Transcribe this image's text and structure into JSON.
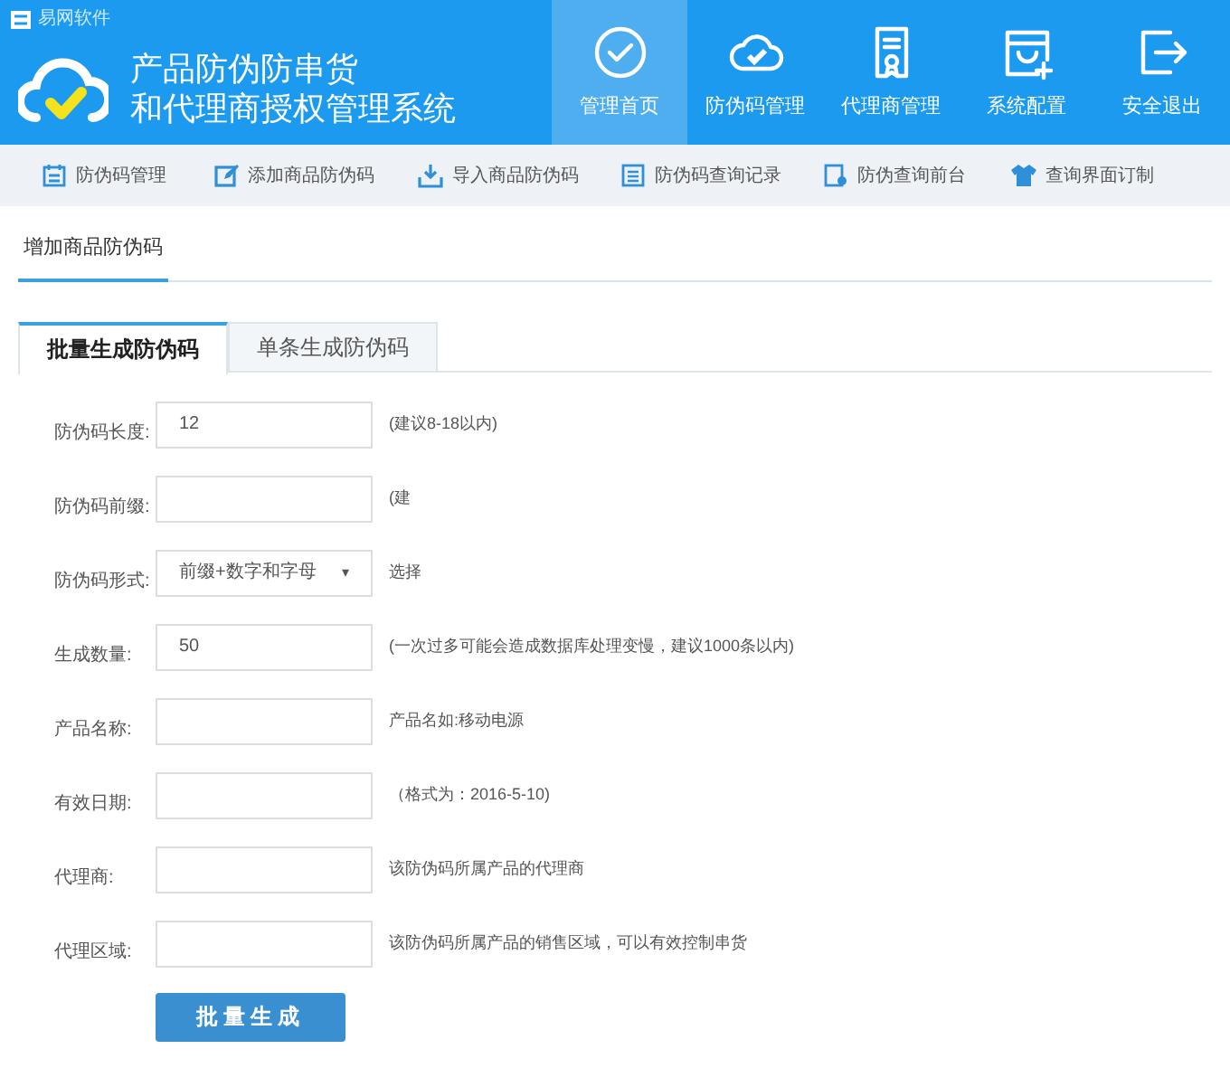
{
  "brand": {
    "vendor": "易网软件",
    "title_line_1": "产品防伪防串货",
    "title_line_2": "和代理商授权管理系统"
  },
  "nav": [
    {
      "label": "管理首页",
      "selected": true
    },
    {
      "label": "防伪码管理",
      "selected": false
    },
    {
      "label": "代理商管理",
      "selected": false
    },
    {
      "label": "系统配置",
      "selected": false
    },
    {
      "label": "安全退出",
      "selected": false
    }
  ],
  "subnav": [
    {
      "label": "防伪码管理"
    },
    {
      "label": "添加商品防伪码"
    },
    {
      "label": "导入商品防伪码"
    },
    {
      "label": "防伪码查询记录"
    },
    {
      "label": "防伪查询前台"
    },
    {
      "label": "查询界面订制"
    }
  ],
  "section_title": "增加商品防伪码",
  "tabs": [
    {
      "label": "批量生成防伪码",
      "selected": true
    },
    {
      "label": "单条生成防伪码",
      "selected": false
    }
  ],
  "fields": [
    {
      "kind": "text",
      "label": "防伪码长度:",
      "value": "12",
      "hint": "(建议8-18以内)"
    },
    {
      "kind": "text",
      "label": "防伪码前缀:",
      "hint": "(建"
    },
    {
      "kind": "select",
      "label": "防伪码形式:",
      "value": "前缀+数字和字母",
      "caret": "▾",
      "hint": "选择"
    },
    {
      "kind": "text",
      "label": "生成数量:",
      "value": "50",
      "hint": "(一次过多可能会造成数据库处理变慢，建议1000条以内)"
    },
    {
      "kind": "text",
      "label": "产品名称:",
      "hint": "产品名如:移动电源"
    },
    {
      "kind": "text",
      "label": "有效日期:",
      "hint": "（格式为：2016-5-10)"
    },
    {
      "kind": "text",
      "label": "代理商:",
      "hint": "该防伪码所属产品的代理商"
    },
    {
      "kind": "text",
      "label": "代理区域:",
      "hint": "该防伪码所属产品的销售区域，可以有效控制串货"
    }
  ],
  "submit": "批量生成"
}
